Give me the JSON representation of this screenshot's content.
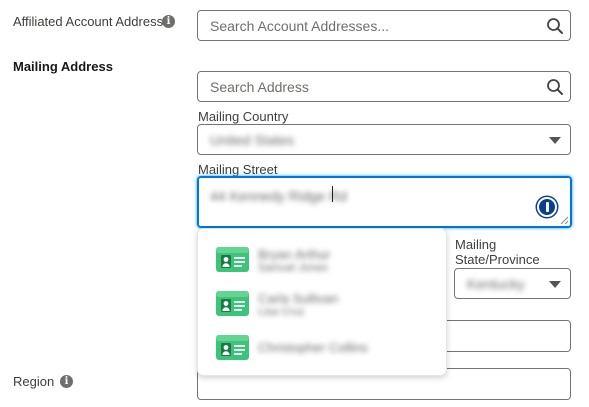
{
  "affiliated_account_address": {
    "label": "Affiliated Account Address",
    "placeholder": "Search Account Addresses..."
  },
  "mailing_address": {
    "section_label": "Mailing Address",
    "search_placeholder": "Search Address",
    "country": {
      "label": "Mailing Country",
      "value": "United States"
    },
    "street": {
      "label": "Mailing Street",
      "value": "44 Kennedy Ridge Rd"
    },
    "state": {
      "label_line1": "Mailing",
      "label_line2": "State/Province",
      "value": "Kentucky"
    }
  },
  "suggestions": [
    {
      "line1": "Bryan Arthur",
      "line2": "Samuel Jones"
    },
    {
      "line1": "Carla Sullivan",
      "line2": "Lisa Cruz"
    },
    {
      "line1": "Christopher Collins"
    }
  ],
  "region": {
    "label": "Region"
  },
  "colors": {
    "focus_border": "#0176d3",
    "card_icon_green": "#3cc57a",
    "info_icon": "#706e6b"
  },
  "icons": [
    "info-icon",
    "search-icon",
    "chevron-down-icon",
    "contact-card-icon",
    "password-manager-icon"
  ]
}
